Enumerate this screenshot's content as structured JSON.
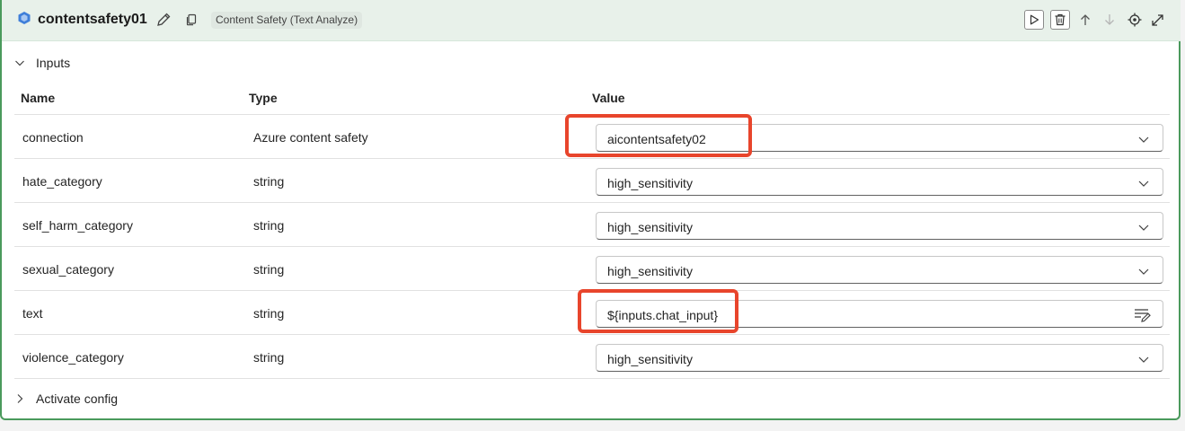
{
  "node": {
    "title": "contentsafety01",
    "tool_badge": "Content Safety (Text Analyze)",
    "accent_color": "#4a9a5c"
  },
  "sections": {
    "inputs_label": "Inputs",
    "activate_label": "Activate config"
  },
  "table": {
    "headers": {
      "name": "Name",
      "type": "Type",
      "value": "Value"
    },
    "rows": [
      {
        "name": "connection",
        "type": "Azure content safety",
        "value": "aicontentsafety02",
        "control": "dropdown"
      },
      {
        "name": "hate_category",
        "type": "string",
        "value": "high_sensitivity",
        "control": "dropdown"
      },
      {
        "name": "self_harm_category",
        "type": "string",
        "value": "high_sensitivity",
        "control": "dropdown"
      },
      {
        "name": "sexual_category",
        "type": "string",
        "value": "high_sensitivity",
        "control": "dropdown"
      },
      {
        "name": "text",
        "type": "string",
        "value": "${inputs.chat_input}",
        "control": "text"
      },
      {
        "name": "violence_category",
        "type": "string",
        "value": "high_sensitivity",
        "control": "dropdown"
      }
    ]
  },
  "icons": [
    "node-type-icon",
    "pencil-icon",
    "copy-icon",
    "play-icon",
    "trash-icon",
    "arrow-up-icon",
    "arrow-down-icon",
    "locate-icon",
    "expand-icon",
    "chevron-down-icon",
    "chevron-right-icon",
    "text-edit-icon"
  ],
  "highlight_color": "#e8452c"
}
